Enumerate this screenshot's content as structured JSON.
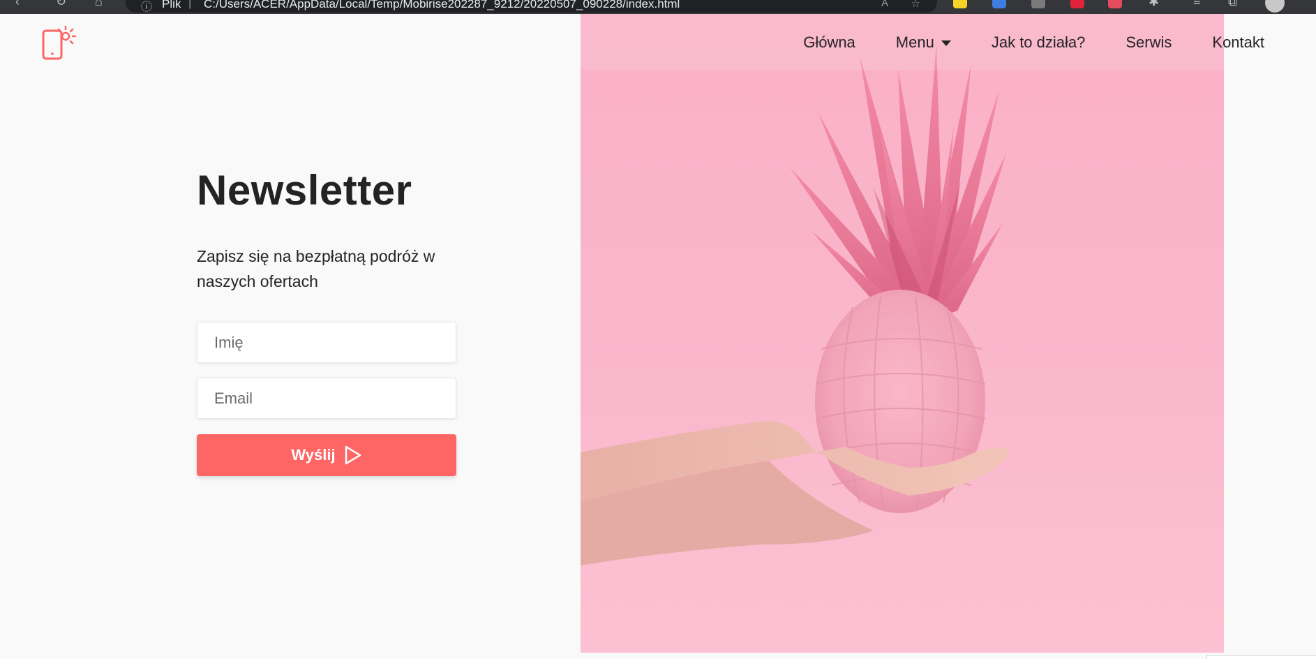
{
  "browser": {
    "site_info": "Plik",
    "separator": "|",
    "url": "C:/Users/ACER/AppData/Local/Temp/Mobirise202287_9212/20220507_090228/index.html"
  },
  "nav": {
    "items": [
      {
        "label": "Główna"
      },
      {
        "label": "Menu"
      },
      {
        "label": "Jak to działa?"
      },
      {
        "label": "Serwis"
      },
      {
        "label": "Kontakt"
      }
    ]
  },
  "newsletter": {
    "title": "Newsletter",
    "subtitle": "Zapisz się na bezpłatną podróż w naszych ofertach",
    "name_placeholder": "Imię",
    "email_placeholder": "Email",
    "submit_label": "Wyślij"
  },
  "colors": {
    "accent": "#fe6565",
    "background": "#f9f9f9",
    "hero_pink": "#fbb1c8",
    "text": "#232323"
  }
}
